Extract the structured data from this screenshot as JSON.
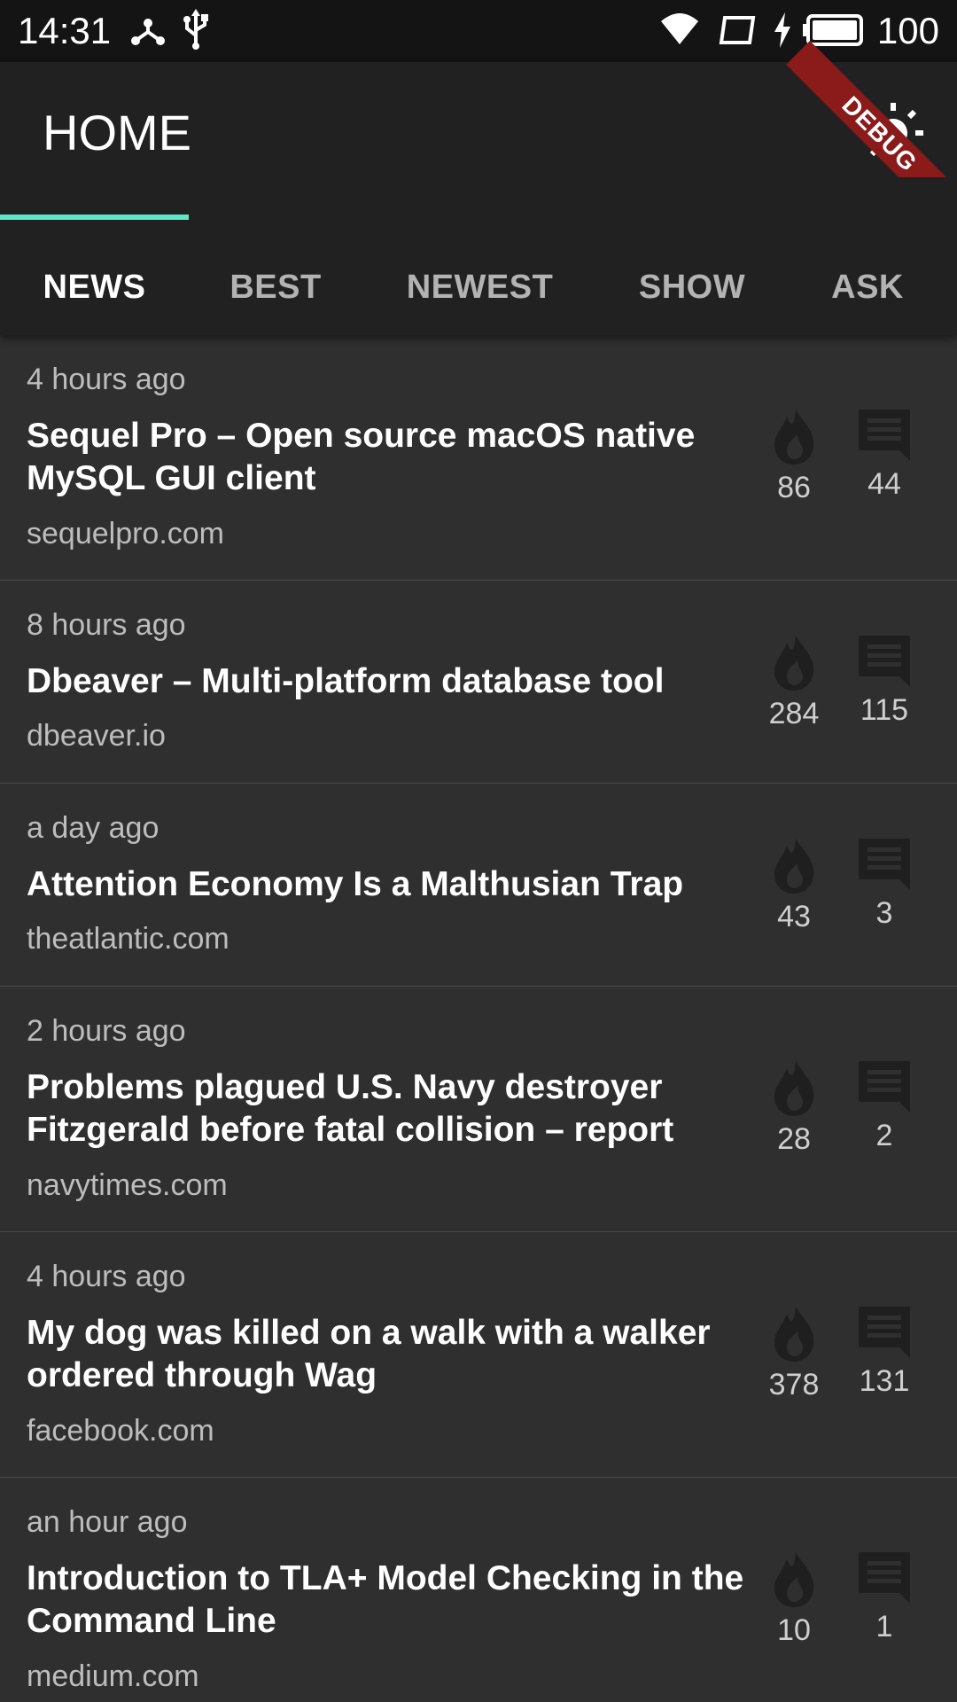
{
  "status_bar": {
    "time": "14:31",
    "battery": "100",
    "icons": [
      "network-hub-icon",
      "usb-icon",
      "wifi-icon",
      "screen-rotation-icon",
      "charging-icon",
      "battery-icon"
    ]
  },
  "app_bar": {
    "title": "HOME",
    "theme_toggle_icon": "sun-icon",
    "debug_banner": "DEBUG"
  },
  "tabs": [
    {
      "label": "NEWS",
      "active": true
    },
    {
      "label": "BEST",
      "active": false
    },
    {
      "label": "NEWEST",
      "active": false
    },
    {
      "label": "SHOW",
      "active": false
    },
    {
      "label": "ASK",
      "active": false
    }
  ],
  "colors": {
    "accent": "#5ee7c8",
    "app_bar": "#212121",
    "background": "#2f2f2f",
    "debug_banner": "#8b1a1a"
  },
  "stories": [
    {
      "time": "4 hours ago",
      "title": "Sequel Pro – Open source macOS native MySQL GUI client",
      "domain": "sequelpro.com",
      "score": "86",
      "comments": "44"
    },
    {
      "time": "8 hours ago",
      "title": "Dbeaver – Multi-platform database tool",
      "domain": "dbeaver.io",
      "score": "284",
      "comments": "115"
    },
    {
      "time": "a day ago",
      "title": "Attention Economy Is a Malthusian Trap",
      "domain": "theatlantic.com",
      "score": "43",
      "comments": "3"
    },
    {
      "time": "2 hours ago",
      "title": "Problems plagued U.S. Navy destroyer Fitzgerald before fatal collision – report",
      "domain": "navytimes.com",
      "score": "28",
      "comments": "2"
    },
    {
      "time": "4 hours ago",
      "title": "My dog was killed on a walk with a walker ordered through Wag",
      "domain": "facebook.com",
      "score": "378",
      "comments": "131"
    },
    {
      "time": "an hour ago",
      "title": "Introduction to TLA+ Model Checking in the Command Line",
      "domain": "medium.com",
      "score": "10",
      "comments": "1"
    }
  ]
}
